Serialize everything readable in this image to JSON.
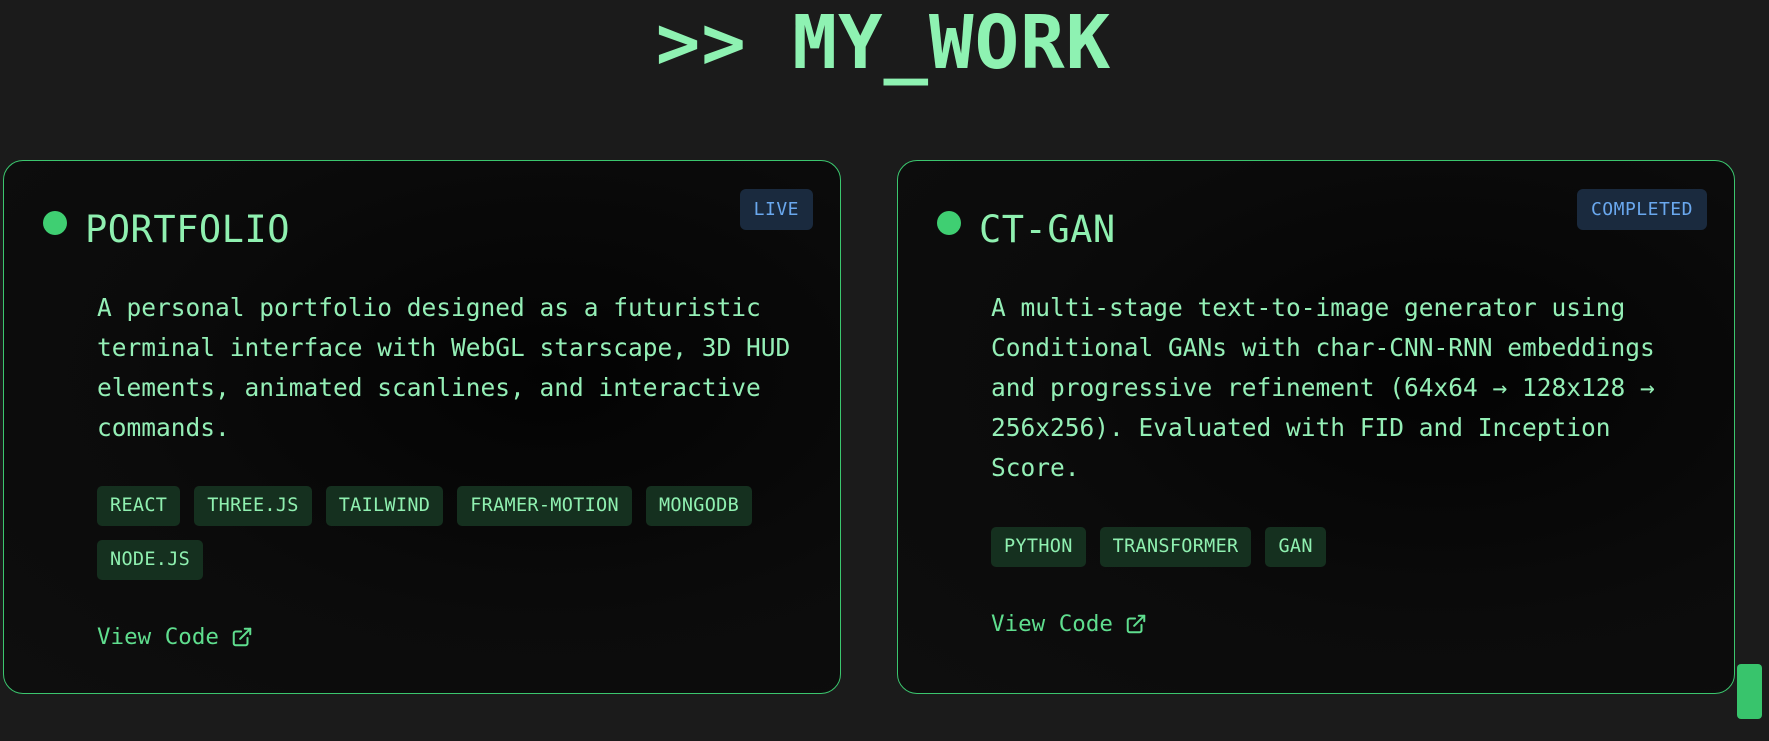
{
  "section": {
    "title": ">> MY_WORK"
  },
  "projects": [
    {
      "name": "PORTFOLIO",
      "status": "LIVE",
      "description": "A personal portfolio designed as a futuristic terminal interface with WebGL starscape, 3D HUD elements, animated scanlines, and interactive commands.",
      "tags": [
        "REACT",
        "THREE.JS",
        "TAILWIND",
        "FRAMER-MOTION",
        "MONGODB",
        "NODE.JS"
      ],
      "link_label": "View Code",
      "link_icon": "external-link-icon"
    },
    {
      "name": "CT-GAN",
      "status": "COMPLETED",
      "description": "A multi-stage text-to-image generator using Conditional GANs with char-CNN-RNN embeddings and progressive refinement (64x64 → 128x128 → 256x256). Evaluated with FID and Inception Score.",
      "tags": [
        "PYTHON",
        "TRANSFORMER",
        "GAN"
      ],
      "link_label": "View Code",
      "link_icon": "external-link-icon"
    }
  ],
  "colors": {
    "accent": "#8ff0b0",
    "dot": "#3fcf72",
    "badge_text": "#6aa8ee",
    "background": "#1b1b1b"
  }
}
